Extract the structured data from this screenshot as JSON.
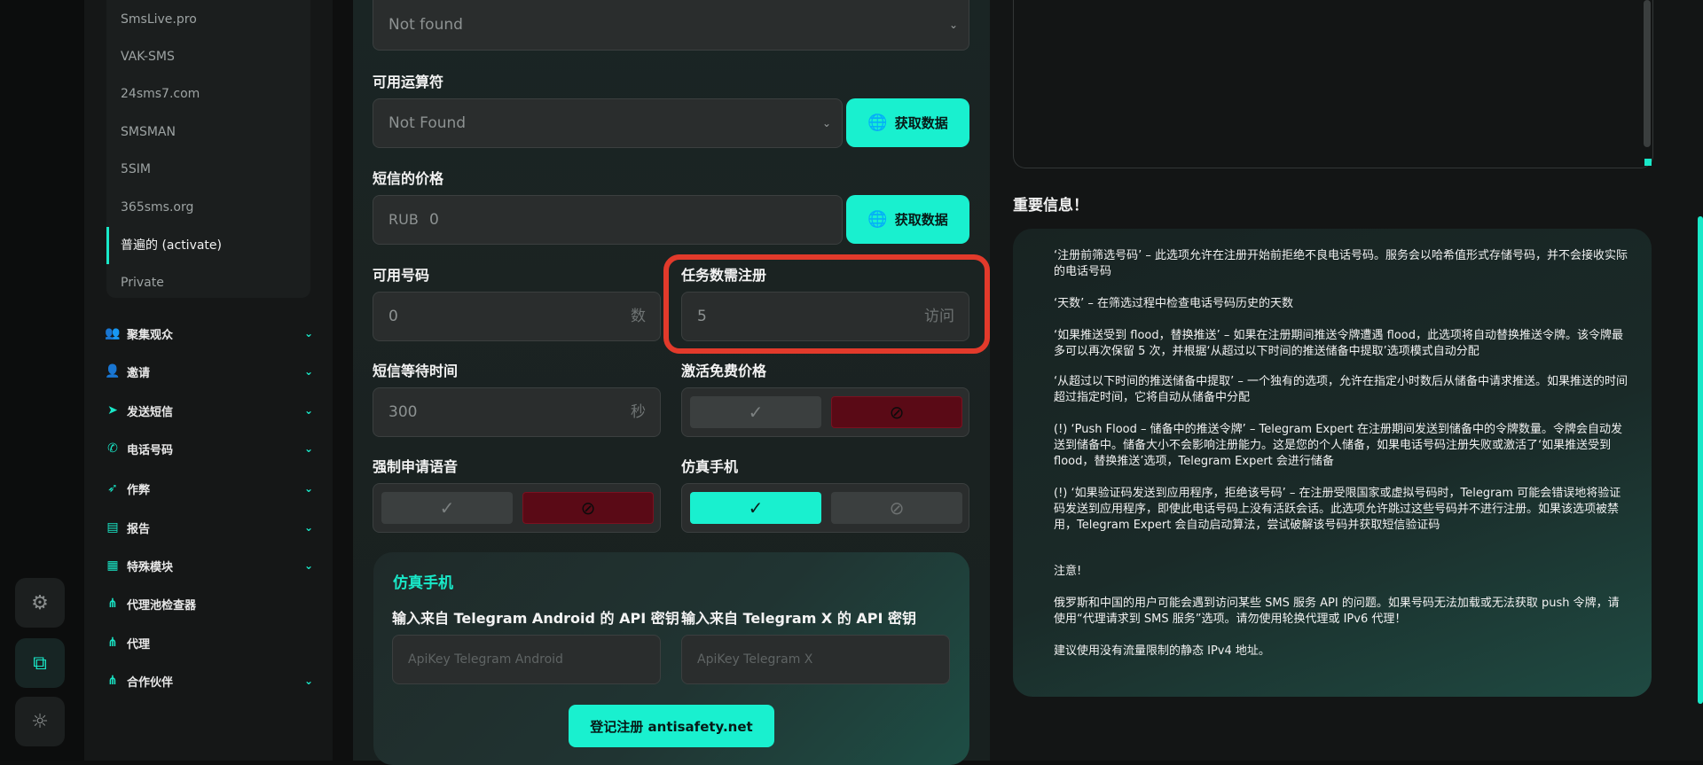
{
  "rail": {
    "icons": [
      "gear-icon",
      "external-link-icon",
      "sun-icon"
    ]
  },
  "sidebar": {
    "sub_items": [
      "SmsLive.pro",
      "VAK-SMS",
      "24sms7.com",
      "SMSMAN",
      "5SIM",
      "365sms.org",
      "普遍的 (activate)",
      "Private"
    ],
    "menu": [
      {
        "label": "聚集观众",
        "icon": "users-icon",
        "chevron": true
      },
      {
        "label": "邀请",
        "icon": "user-plus-icon",
        "chevron": true
      },
      {
        "label": "发送短信",
        "icon": "send-icon",
        "chevron": true
      },
      {
        "label": "电话号码",
        "icon": "phone-icon",
        "chevron": true
      },
      {
        "label": "作弊",
        "icon": "send-boost-icon",
        "chevron": true
      },
      {
        "label": "报告",
        "icon": "report-icon",
        "chevron": true
      },
      {
        "label": "特殊模块",
        "icon": "module-icon",
        "chevron": true
      },
      {
        "label": "代理池检查器",
        "icon": "network-icon",
        "chevron": false
      },
      {
        "label": "代理",
        "icon": "network-icon",
        "chevron": false
      },
      {
        "label": "合作伙伴",
        "icon": "network-icon",
        "chevron": true
      }
    ]
  },
  "form": {
    "country_select_value": "Not found",
    "operator_label": "可用运算符",
    "operator_value": "Not Found",
    "fetch_button": "获取数据",
    "price_label": "短信的价格",
    "price_currency": "RUB",
    "price_value": "0",
    "available_label": "可用号码",
    "available_value": "0",
    "available_suffix": "数",
    "tasks_label": "任务数需注册",
    "tasks_value": "5",
    "tasks_suffix": "访问",
    "wait_label": "短信等待时间",
    "wait_value": "300",
    "wait_suffix": "秒",
    "free_price_label": "激活免费价格",
    "voice_label": "强制申请语音",
    "emulate_label": "仿真手机"
  },
  "card": {
    "title": "仿真手机",
    "android_label": "输入来自 Telegram Android 的 API 密钥",
    "android_placeholder": "ApiKey Telegram Android",
    "x_label": "输入来自 Telegram X 的 API 密钥",
    "x_placeholder": "ApiKey Telegram X",
    "register_button": "登记注册 antisafety.net"
  },
  "info": {
    "title": "重要信息！",
    "paragraphs": [
      "‘注册前筛选号码’ – 此选项允许在注册开始前拒绝不良电话号码。服务会以哈希值形式存储号码，并不会接收实际的电话号码",
      "‘天数’ – 在筛选过程中检查电话号码历史的天数",
      "‘如果推送受到 flood，替换推送’ – 如果在注册期间推送令牌遭遇 flood，此选项将自动替换推送令牌。该令牌最多可以再次保留 5 次，并根据‘从超过以下时间的推送储备中提取’选项模式自动分配",
      "‘从超过以下时间的推送储备中提取’ – 一个独有的选项，允许在指定小时数后从储备中请求推送。如果推送的时间超过指定时间，它将自动从储备中分配",
      "(!) ‘Push Flood – 储备中的推送令牌’ – Telegram Expert 在注册期间发送到储备中的令牌数量。令牌会自动发送到储备中。储备大小不会影响注册能力。这是您的个人储备，如果电话号码注册失败或激活了‘如果推送受到 flood，替换推送’选项，Telegram Expert 会进行储备",
      "(!) ‘如果验证码发送到应用程序，拒绝该号码’ – 在注册受限国家或虚拟号码时，Telegram 可能会错误地将验证码发送到应用程序，即使此电话号码上没有活跃会话。此选项允许跳过这些号码并不进行注册。如果该选项被禁用，Telegram Expert 会自动启动算法，尝试破解该号码并获取短信验证码",
      "注意!",
      "俄罗斯和中国的用户可能会遇到访问某些 SMS 服务 API 的问题。如果号码无法加载或无法获取 push 令牌，请使用“代理请求到 SMS 服务”选项。请勿使用轮换代理或 IPv6 代理！",
      "建议使用没有流量限制的静态 IPv4 地址。"
    ]
  },
  "colors": {
    "accent": "#19f0cf",
    "danger": "#5a0a16",
    "highlight": "#e23a2b"
  }
}
